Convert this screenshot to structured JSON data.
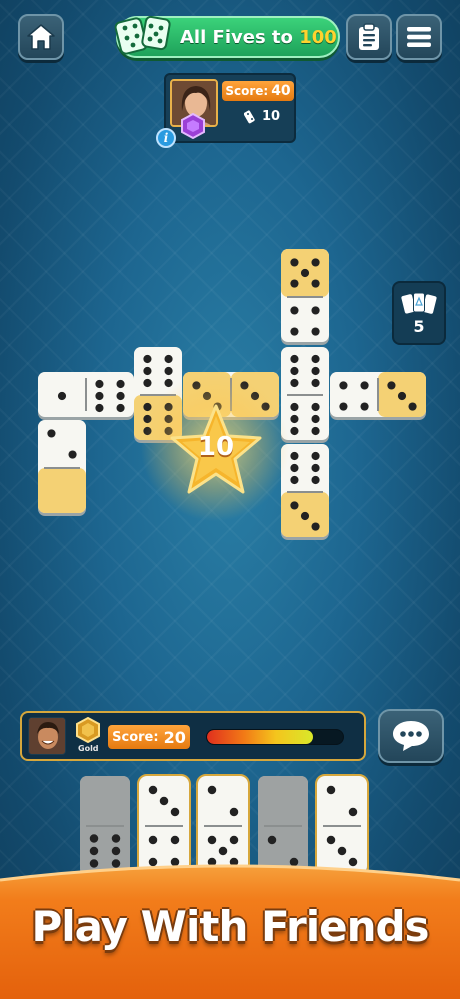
{
  "header": {
    "home_icon": "home-icon",
    "mode_prefix": "All Fives to",
    "mode_target": "100",
    "mode_icon_number": "5",
    "scoresheet_icon": "clipboard-icon",
    "menu_icon": "hamburger-menu-icon"
  },
  "opponent": {
    "score_label": "Score:",
    "score_value": "40",
    "tiles_left": "10",
    "info_label": "i",
    "badge_icon": "purple-gem-badge-icon"
  },
  "boneyard": {
    "count": "5",
    "icon": "stacked-tiles-icon"
  },
  "board": {
    "play_points": "10",
    "highlight_color": "#f3c44a"
  },
  "player": {
    "rank": "Gold",
    "score_label": "Score:",
    "score_value": "20",
    "timer_fraction": 0.78,
    "chat_icon": "speech-bubble-icon"
  },
  "banner": {
    "text": "Play With Friends",
    "color": "#f27d1b"
  }
}
